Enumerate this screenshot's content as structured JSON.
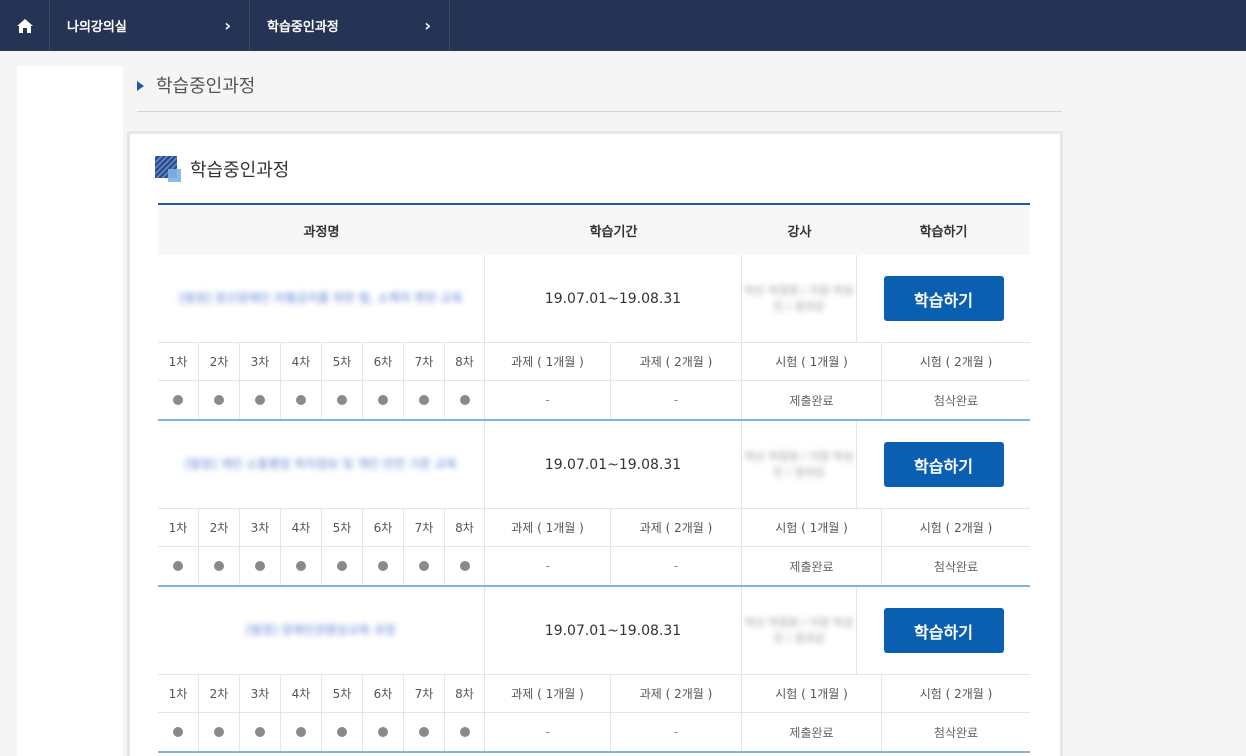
{
  "topbar": {
    "crumbs": [
      "나의강의실",
      "학습중인과정"
    ]
  },
  "page": {
    "title": "학습중인과정"
  },
  "card": {
    "title": "학습중인과정"
  },
  "table": {
    "headers": {
      "name": "과정명",
      "period": "학습기간",
      "teacher": "강사",
      "study": "학습하기"
    },
    "round_labels": [
      "1차",
      "2차",
      "3차",
      "4차",
      "5차",
      "6차",
      "7차",
      "8차"
    ],
    "assignment_labels": [
      "과제 ( 1개월 )",
      "과제 ( 2개월 )"
    ],
    "exam_labels": [
      "시험 ( 1개월 )",
      "시험 ( 2개월 )"
    ]
  },
  "courses": [
    {
      "name": "[법정] 정신장애인 차별금지를 위한 법, 소책자 편찬 교육",
      "period": "19.07.01~19.08.31",
      "teacher": "박산 하정원 / 지원 박성민 / 경과강",
      "study_label": "학습하기",
      "assign1": "-",
      "assign2": "-",
      "exam1": "제출완료",
      "exam2": "첨삭완료"
    },
    {
      "name": "[법정] 개인 소통행정 위치정보 및 개인 안전 기준 교육",
      "period": "19.07.01~19.08.31",
      "teacher": "박산 하정원 / 지원 박성민 / 경과강",
      "study_label": "학습하기",
      "assign1": "-",
      "assign2": "-",
      "exam1": "제출완료",
      "exam2": "첨삭완료"
    },
    {
      "name": "[법정] 장애인권향상교육 과정",
      "period": "19.07.01~19.08.31",
      "teacher": "박산 하정원 / 지원 박성민 / 경과강",
      "study_label": "학습하기",
      "assign1": "-",
      "assign2": "-",
      "exam1": "제출완료",
      "exam2": "첨삭완료"
    }
  ],
  "colors": {
    "nav": "#253354",
    "accent": "#1e5aa8",
    "button": "#0b5fb0",
    "divider": "#7fb4e3"
  }
}
